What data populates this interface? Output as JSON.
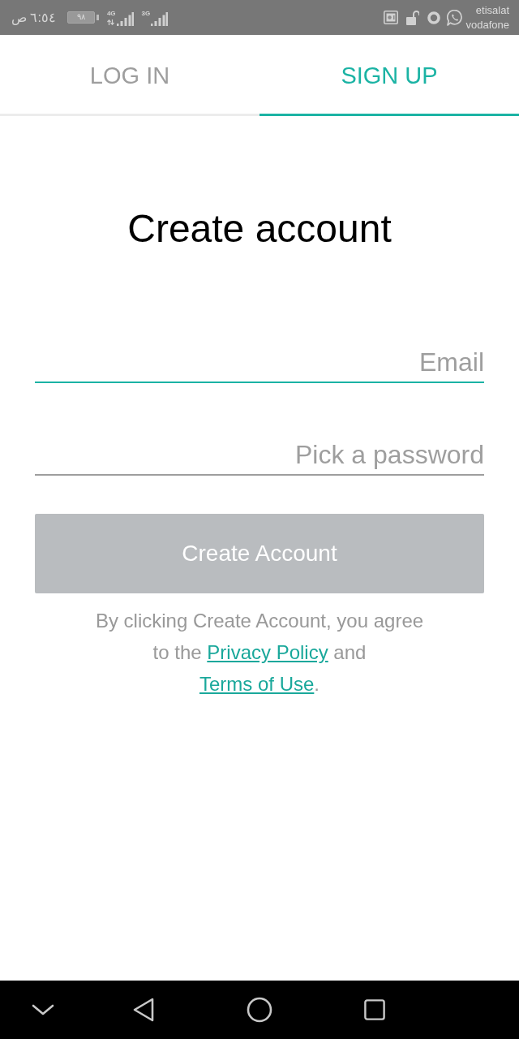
{
  "status_bar": {
    "time": "٦:٥٤ ص",
    "battery": "٩٨",
    "networks": [
      {
        "type": "4G",
        "data_active": true
      },
      {
        "type": "3G",
        "data_active": false
      }
    ],
    "carriers": [
      "etisalat",
      "vodafone"
    ]
  },
  "tabs": [
    {
      "label": "LOG IN",
      "selected": false
    },
    {
      "label": "SIGN UP",
      "selected": true
    }
  ],
  "title": "Create account",
  "fields": [
    {
      "placeholder": "Email",
      "focused": true
    },
    {
      "placeholder": "Pick a password",
      "focused": false
    }
  ],
  "button": {
    "label": "Create Account",
    "disabled": true
  },
  "terms": [
    {
      "kind": "text",
      "text": "By clicking Create Account, you agree to the "
    },
    {
      "kind": "link",
      "text": "Privacy Policy"
    },
    {
      "kind": "text",
      "text": " and "
    },
    {
      "kind": "link",
      "text": "Terms of Use"
    },
    {
      "kind": "text",
      "text": "."
    }
  ]
}
